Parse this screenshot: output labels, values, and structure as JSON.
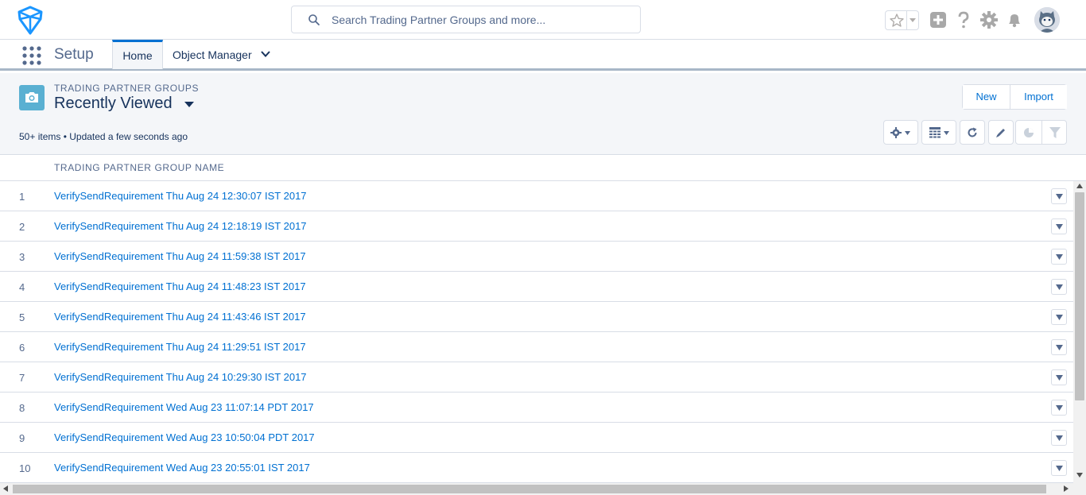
{
  "header": {
    "search_placeholder": "Search Trading Partner Groups and more..."
  },
  "context_bar": {
    "app_name": "Setup",
    "tabs": [
      {
        "label": "Home",
        "active": true
      },
      {
        "label": "Object Manager",
        "active": false
      }
    ]
  },
  "list_view": {
    "object_label": "TRADING PARTNER GROUPS",
    "view_name": "Recently Viewed",
    "meta": "50+ items • Updated a few seconds ago",
    "buttons": {
      "new": "New",
      "import": "Import"
    },
    "column_header": "TRADING PARTNER GROUP NAME",
    "rows": [
      {
        "num": "1",
        "name": "VerifySendRequirement Thu Aug 24 12:30:07 IST 2017"
      },
      {
        "num": "2",
        "name": "VerifySendRequirement Thu Aug 24 12:18:19 IST 2017"
      },
      {
        "num": "3",
        "name": "VerifySendRequirement Thu Aug 24 11:59:38 IST 2017"
      },
      {
        "num": "4",
        "name": "VerifySendRequirement Thu Aug 24 11:48:23 IST 2017"
      },
      {
        "num": "5",
        "name": "VerifySendRequirement Thu Aug 24 11:43:46 IST 2017"
      },
      {
        "num": "6",
        "name": "VerifySendRequirement Thu Aug 24 11:29:51 IST 2017"
      },
      {
        "num": "7",
        "name": "VerifySendRequirement Thu Aug 24 10:29:30 IST 2017"
      },
      {
        "num": "8",
        "name": "VerifySendRequirement Wed Aug 23 11:07:14 PDT 2017"
      },
      {
        "num": "9",
        "name": "VerifySendRequirement Wed Aug 23 10:50:04 PDT 2017"
      },
      {
        "num": "10",
        "name": "VerifySendRequirement Wed Aug 23 20:55:01 IST 2017"
      }
    ]
  },
  "colors": {
    "brand_blue": "#0070d2",
    "text_dark": "#16325c",
    "text_weak": "#54698d",
    "icon_gray": "#b0adab",
    "object_icon": "#5ab0d2"
  },
  "icons": [
    "logo",
    "search-icon",
    "star-icon",
    "add-icon",
    "help-icon",
    "setup-gear-icon",
    "notification-bell-icon",
    "avatar",
    "app-launcher-icon",
    "camera-icon",
    "settings-gear-icon",
    "table-icon",
    "refresh-icon",
    "edit-icon",
    "chart-icon",
    "filter-icon"
  ]
}
